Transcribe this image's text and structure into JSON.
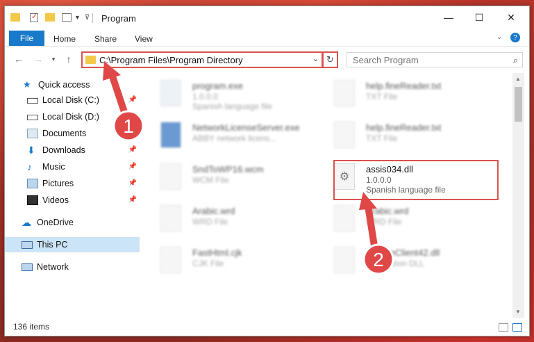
{
  "window": {
    "title": "Program",
    "controls": {
      "minimize": "—",
      "maximize": "☐",
      "close": "✕"
    }
  },
  "ribbon": {
    "tabs": [
      "File",
      "Home",
      "Share",
      "View"
    ]
  },
  "address": {
    "path": "C:\\Program Files\\Program Directory"
  },
  "search": {
    "placeholder": "Search Program"
  },
  "sidebar": {
    "items": [
      {
        "label": "Quick access",
        "icon": "star-icon",
        "pinned": false
      },
      {
        "label": "Local Disk (C:)",
        "icon": "drive-icon",
        "pinned": true
      },
      {
        "label": "Local Disk (D:)",
        "icon": "drive-icon",
        "pinned": false
      },
      {
        "label": "Documents",
        "icon": "documents-icon",
        "pinned": true
      },
      {
        "label": "Downloads",
        "icon": "download-icon",
        "pinned": true
      },
      {
        "label": "Music",
        "icon": "music-icon",
        "pinned": true
      },
      {
        "label": "Pictures",
        "icon": "pictures-icon",
        "pinned": true
      },
      {
        "label": "Videos",
        "icon": "videos-icon",
        "pinned": true
      },
      {
        "label": "OneDrive",
        "icon": "cloud-icon",
        "pinned": false
      },
      {
        "label": "This PC",
        "icon": "computer-icon",
        "pinned": false,
        "selected": true
      },
      {
        "label": "Network",
        "icon": "network-icon",
        "pinned": false
      }
    ]
  },
  "files": [
    {
      "name": "program.exe",
      "line2": "1.0.0.0",
      "line3": "Spanish language file"
    },
    {
      "name": "help.fineReader.txt",
      "line2": "TXT File",
      "line3": ""
    },
    {
      "name": "NetworkLicenseServer.exe",
      "line2": "ABBY network licens...",
      "line3": ""
    },
    {
      "name": "help.fineReader.txt",
      "line2": "TXT File",
      "line3": ""
    },
    {
      "name": "SndToWP16.wcm",
      "line2": "WCM File",
      "line3": ""
    },
    {
      "name": "assis034.dll",
      "line2": "1.0.0.0",
      "line3": "Spanish language file"
    },
    {
      "name": "Arabic.wrd",
      "line2": "WRD File",
      "line3": ""
    },
    {
      "name": "Arabic.wrd",
      "line2": "WRD File",
      "line3": ""
    },
    {
      "name": "FastHtml.cjk",
      "line2": "CJK File",
      "line3": ""
    },
    {
      "name": "UpdateClient42.dll",
      "line2": "Application DLL",
      "line3": ""
    }
  ],
  "status": {
    "count": "136 items"
  },
  "annotations": {
    "step1": "1",
    "step2": "2",
    "color": "#e04848"
  }
}
